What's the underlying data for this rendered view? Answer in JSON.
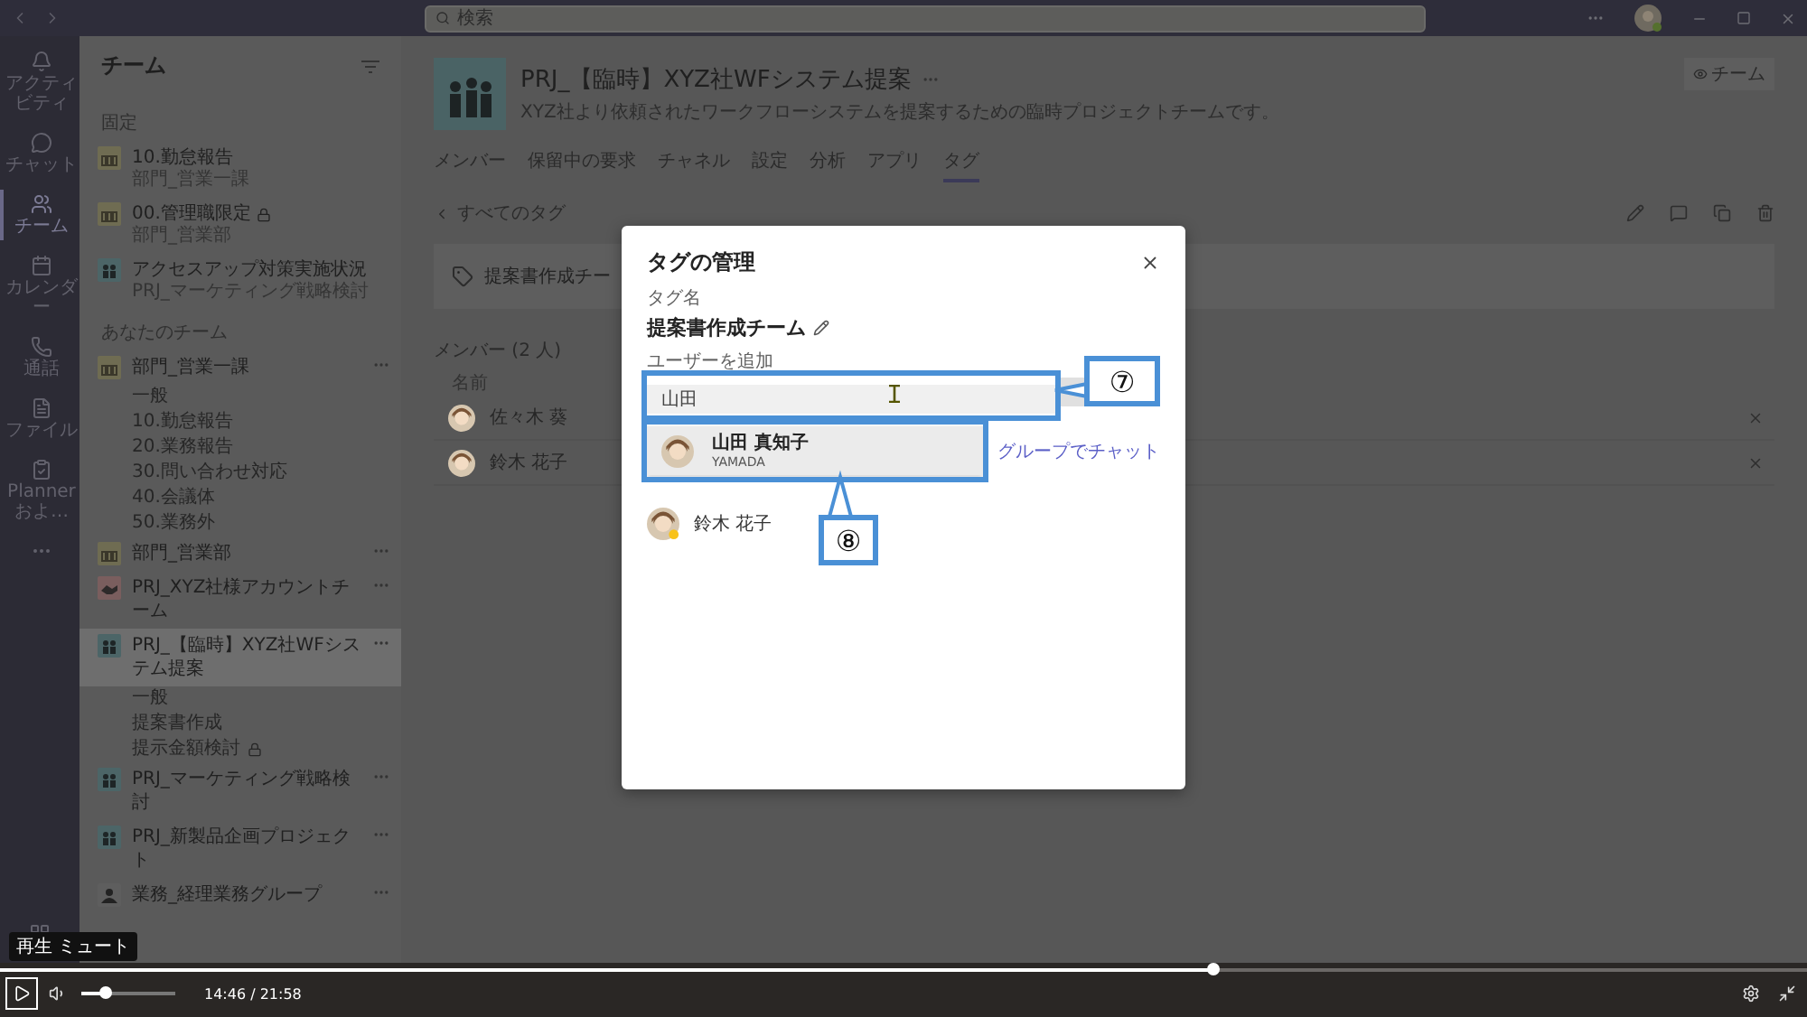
{
  "search": {
    "placeholder": "検索"
  },
  "rail": [
    {
      "kind": "activity",
      "label": "アクティビティ",
      "selected": false
    },
    {
      "kind": "chat",
      "label": "チャット",
      "selected": false
    },
    {
      "kind": "teams",
      "label": "チーム",
      "selected": true
    },
    {
      "kind": "calendar",
      "label": "カレンダー",
      "selected": false
    },
    {
      "kind": "calls",
      "label": "通話",
      "selected": false
    },
    {
      "kind": "files",
      "label": "ファイル",
      "selected": false
    },
    {
      "kind": "planner",
      "label": "Planner およ…",
      "selected": false
    },
    {
      "kind": "more",
      "selected": false
    }
  ],
  "team_panel": {
    "title": "チーム",
    "sections": [
      {
        "heading": "固定",
        "teams": [
          {
            "name": "10.勤怠報告",
            "subtitle": "部門_営業一課",
            "kind": "building",
            "locked": false
          },
          {
            "name": "00.管理職限定",
            "subtitle": "部門_営業部",
            "kind": "building",
            "locked": true
          },
          {
            "name": "アクセスアップ対策実施状況",
            "subtitle": "PRJ_マーケティング戦略検討",
            "kind": "people",
            "locked": false
          }
        ]
      },
      {
        "heading": "あなたのチーム",
        "teams": [
          {
            "name": "部門_営業一課",
            "kind": "building",
            "selected": false,
            "children": [
              {
                "name": "一般",
                "locked": false
              },
              {
                "name": "10.勤怠報告",
                "locked": false
              },
              {
                "name": "20.業務報告",
                "locked": false
              },
              {
                "name": "30.問い合わせ対応",
                "locked": false
              },
              {
                "name": "40.会議体",
                "locked": false
              },
              {
                "name": "50.業務外",
                "locked": false
              }
            ]
          },
          {
            "name": "部門_営業部",
            "kind": "building",
            "selected": false
          },
          {
            "name": "PRJ_XYZ社様アカウントチーム",
            "kind": "handshake",
            "selected": false
          },
          {
            "name": "PRJ_【臨時】XYZ社WFシステム提案",
            "kind": "people",
            "selected": true,
            "children": [
              {
                "name": "一般",
                "locked": false
              },
              {
                "name": "提案書作成",
                "locked": false
              },
              {
                "name": "提示金額検討",
                "locked": true
              }
            ]
          },
          {
            "name": "PRJ_マーケティング戦略検討",
            "kind": "people",
            "selected": false
          },
          {
            "name": "PRJ_新製品企画プロジェクト",
            "kind": "people",
            "selected": false
          },
          {
            "name": "業務_経理業務グループ",
            "kind": "group",
            "selected": false
          }
        ]
      }
    ]
  },
  "main": {
    "title": "PRJ_【臨時】XYZ社WFシステム提案",
    "description": "XYZ社より依頼されたワークフローシステムを提案するための臨時プロジェクトチームです。",
    "team_button": "チーム",
    "tabs": [
      {
        "label": "メンバー",
        "selected": false
      },
      {
        "label": "保留中の要求",
        "selected": false
      },
      {
        "label": "チャネル",
        "selected": false
      },
      {
        "label": "設定",
        "selected": false
      },
      {
        "label": "分析",
        "selected": false
      },
      {
        "label": "アプリ",
        "selected": false
      },
      {
        "label": "タグ",
        "selected": true
      }
    ],
    "back_link": "すべてのタグ",
    "tag_card": "提案書作成チー",
    "members_heading": "メンバー (2 人)",
    "column": "名前",
    "members": [
      {
        "name": "佐々木 葵"
      },
      {
        "name": "鈴木 花子"
      }
    ]
  },
  "dialog": {
    "title": "タグの管理",
    "tag_name_label": "タグ名",
    "tag_name": "提案書作成チーム",
    "add_user_label": "ユーザーを追加",
    "input_value": "山田",
    "suggestions": [
      {
        "name": "山田 真知子",
        "detail": "YAMADA",
        "selected": true
      }
    ],
    "chat_link": "グループでチャット",
    "members": [
      {
        "name": "鈴木 花子"
      }
    ]
  },
  "callouts": [
    {
      "label": "⑦"
    },
    {
      "label": "⑧"
    }
  ],
  "player": {
    "tooltip": "再生 ミュート",
    "progress": {
      "level": 0.671
    },
    "volume": {
      "level": 0.25
    },
    "time": "14:46 / 21:58"
  }
}
